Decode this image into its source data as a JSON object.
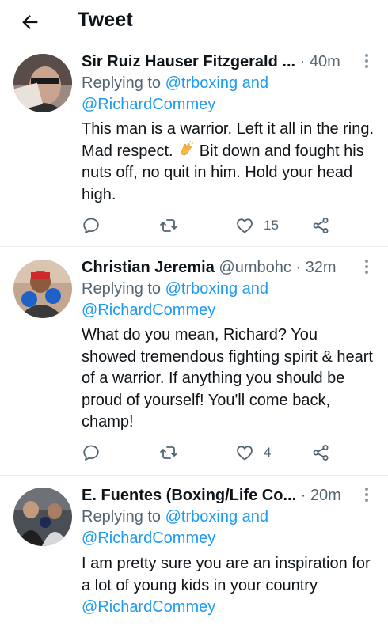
{
  "header": {
    "title": "Tweet"
  },
  "tweets": [
    {
      "name": "Sir Ruiz Hauser Fitzgerald ...",
      "handle": "",
      "time": "40m",
      "replying_prefix": "Replying to ",
      "mention1": "@trboxing",
      "and": " and",
      "mention2": "@RichardCommey",
      "text_a": "This man is a warrior. Left it all in the ring. Mad respect. ",
      "text_b": " Bit down and fought his nuts off, no quit in him. Hold your head high.",
      "likes": "15"
    },
    {
      "name": "Christian Jeremia",
      "handle": "@umbohc",
      "time": "32m",
      "replying_prefix": "Replying to ",
      "mention1": "@trboxing",
      "and": " and",
      "mention2": "@RichardCommey",
      "text": "What do you mean, Richard? You showed tremendous fighting spirit & heart of a warrior. If anything you should be proud of yourself! You'll come back, champ!",
      "likes": "4"
    },
    {
      "name": "E. Fuentes (Boxing/Life Co...",
      "handle": "",
      "time": "20m",
      "replying_prefix": "Replying to ",
      "mention1": "@trboxing",
      "and": " and",
      "mention2": "@RichardCommey",
      "text": "I am pretty sure you are an inspiration for a lot of young kids in your country",
      "mention3": "@RichardCommey"
    }
  ],
  "colors": {
    "accent": "#1d9bf0",
    "secondary_text": "#536471",
    "divider": "#e6ecf0"
  },
  "icons": [
    "back-arrow-icon",
    "more-icon",
    "reply-icon",
    "retweet-icon",
    "like-icon",
    "share-icon",
    "clapping-hands-emoji"
  ]
}
